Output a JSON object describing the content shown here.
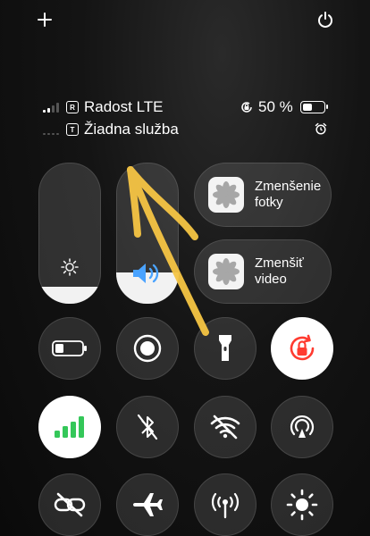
{
  "top": {
    "add_icon": "plus-icon",
    "power_icon": "power-icon"
  },
  "status": {
    "sim1_tag": "R",
    "carrier1": "Radost LTE",
    "sim2_tag": "T",
    "carrier2": "Žiadna služba",
    "battery_text": "50 %",
    "battery_level": 0.5
  },
  "sliders": {
    "brightness_level": 0.12,
    "volume_level": 0.22
  },
  "shortcuts": [
    {
      "line1": "Zmenšenie",
      "line2": "fotky"
    },
    {
      "line1": "Zmenšiť",
      "line2": "video"
    }
  ],
  "colors": {
    "cellular_green": "#34c759",
    "rotation_lock_red": "#ff3b30",
    "annotation_yellow": "#f6c544"
  }
}
